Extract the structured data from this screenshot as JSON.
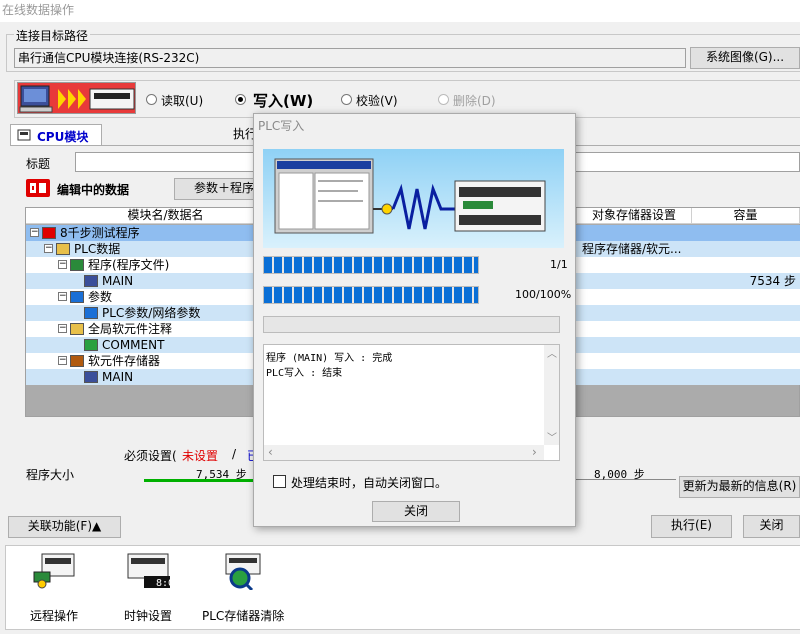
{
  "window": {
    "title": "在线数据操作"
  },
  "connection": {
    "group_label": "连接目标路径",
    "path_value": "串行通信CPU模块连接(RS-232C)",
    "system_image_button": "系统图像(G)..."
  },
  "operations": [
    {
      "label": "读取(U)",
      "selected": false,
      "disabled": false
    },
    {
      "label": "写入(W)",
      "selected": true,
      "disabled": false
    },
    {
      "label": "校验(V)",
      "selected": false,
      "disabled": false
    },
    {
      "label": "删除(D)",
      "selected": false,
      "disabled": true
    }
  ],
  "tabs": {
    "cpu_module": "CPU模块",
    "exec_prefix": "执行"
  },
  "title_field": {
    "label": "标题",
    "value": ""
  },
  "editing": {
    "label": "编辑中的数据",
    "param_prog_button": "参数＋程序"
  },
  "table": {
    "headers": [
      "模块名/数据名",
      "对象存储器设置",
      "容量"
    ],
    "rows": [
      {
        "name": "8千步测试程序",
        "target": "",
        "capacity": "",
        "icon": "plc-project-icon",
        "level": 0,
        "expand": "minus"
      },
      {
        "name": "PLC数据",
        "target": "程序存储器/软元...",
        "capacity": "",
        "icon": "folder-icon",
        "level": 1,
        "expand": "minus"
      },
      {
        "name": "程序(程序文件)",
        "target": "",
        "capacity": "",
        "icon": "program-folder-icon",
        "level": 2,
        "expand": "minus"
      },
      {
        "name": "MAIN",
        "target": "",
        "capacity": "7534 步",
        "icon": "program-file-icon",
        "level": 3,
        "expand": ""
      },
      {
        "name": "参数",
        "target": "",
        "capacity": "",
        "icon": "parameter-folder-icon",
        "level": 2,
        "expand": "minus"
      },
      {
        "name": "PLC参数/网络参数",
        "target": "",
        "capacity": "",
        "icon": "parameter-icon",
        "level": 3,
        "expand": ""
      },
      {
        "name": "全局软元件注释",
        "target": "",
        "capacity": "",
        "icon": "comment-folder-icon",
        "level": 2,
        "expand": "minus"
      },
      {
        "name": "COMMENT",
        "target": "",
        "capacity": "",
        "icon": "comment-icon",
        "level": 3,
        "expand": ""
      },
      {
        "name": "软元件存储器",
        "target": "",
        "capacity": "",
        "icon": "device-memory-folder-icon",
        "level": 2,
        "expand": "minus"
      },
      {
        "name": "MAIN",
        "target": "",
        "capacity": "",
        "icon": "device-memory-icon",
        "level": 3,
        "expand": ""
      }
    ]
  },
  "settings": {
    "required_prefix": "必须设置(",
    "not_set": "未设置",
    "slash": "/",
    "partial": "已",
    "program_size_label": "程序大小",
    "program_size_value": "7,534 步",
    "capacity_value": "8,000 步",
    "refresh_button": "更新为最新的信息(R)"
  },
  "footer": {
    "related_button": "关联功能(F)▲",
    "execute_button": "执行(E)",
    "close_button": "关闭"
  },
  "shortcuts": [
    {
      "label": "远程操作",
      "icon": "remote-operation-icon"
    },
    {
      "label": "时钟设置",
      "icon": "clock-setting-icon",
      "clock_text": "8:00"
    },
    {
      "label": "PLC存储器清除",
      "icon": "plc-memory-clear-icon"
    }
  ],
  "dialog": {
    "title": "PLC写入",
    "progress1": {
      "value": 1,
      "max": 1,
      "text": "1/1"
    },
    "progress2": {
      "percent": 100,
      "text": "100/100%"
    },
    "log": [
      "程序 (MAIN) 写入 : 完成",
      "PLC写入 : 结束"
    ],
    "auto_close_label": "处理结束时，自动关闭窗口。",
    "auto_close_checked": false,
    "close_button": "关闭"
  },
  "colors": {
    "selected_row": "#8fbdf0",
    "highlight_row": "#cde4f7",
    "progress_blue": "#0a6fd6",
    "red_text": "#e00000",
    "blue_text": "#0000cc"
  }
}
